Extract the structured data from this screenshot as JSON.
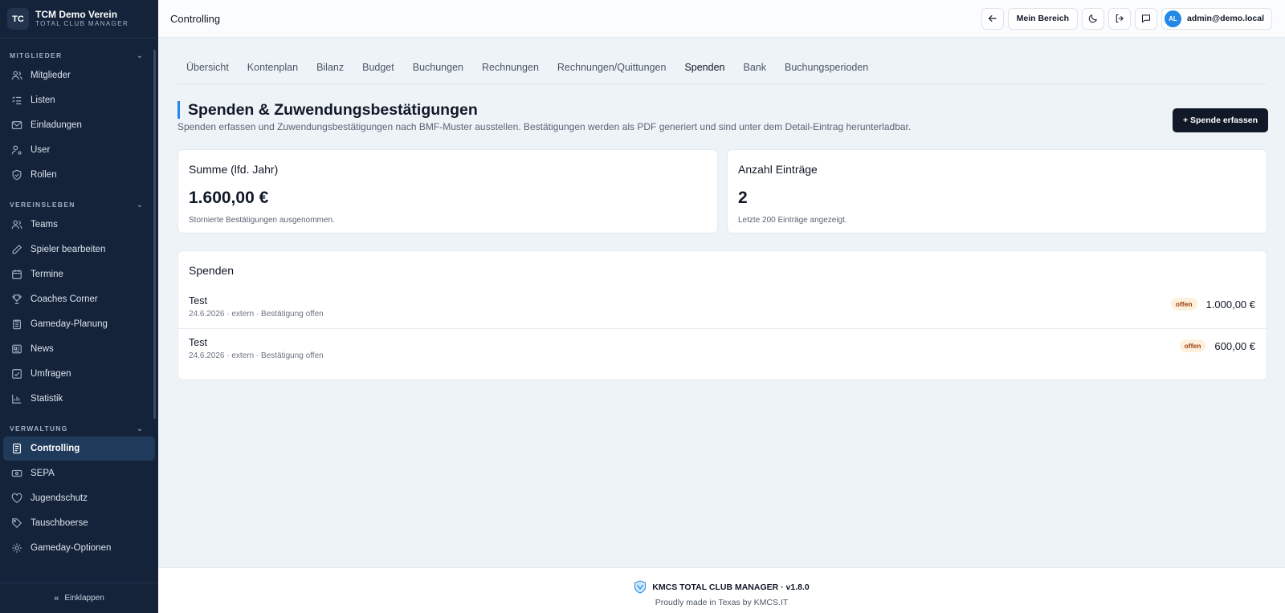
{
  "sidebar": {
    "logo": "TC",
    "org_name": "TCM Demo Verein",
    "org_sub": "TOTAL CLUB MANAGER",
    "sections": [
      {
        "title": "MITGLIEDER",
        "items": [
          {
            "label": "Mitglieder",
            "icon": "users-icon"
          },
          {
            "label": "Listen",
            "icon": "list-icon"
          },
          {
            "label": "Einladungen",
            "icon": "mail-icon"
          },
          {
            "label": "User",
            "icon": "user-cog-icon"
          },
          {
            "label": "Rollen",
            "icon": "shield-icon"
          }
        ]
      },
      {
        "title": "VEREINSLEBEN",
        "items": [
          {
            "label": "Teams",
            "icon": "users-icon"
          },
          {
            "label": "Spieler bearbeiten",
            "icon": "pencil-icon"
          },
          {
            "label": "Termine",
            "icon": "calendar-icon"
          },
          {
            "label": "Coaches Corner",
            "icon": "trophy-icon"
          },
          {
            "label": "Gameday-Planung",
            "icon": "clipboard-icon"
          },
          {
            "label": "News",
            "icon": "newspaper-icon"
          },
          {
            "label": "Umfragen",
            "icon": "poll-icon"
          },
          {
            "label": "Statistik",
            "icon": "bar-chart-icon"
          }
        ]
      },
      {
        "title": "VERWALTUNG",
        "items": [
          {
            "label": "Controlling",
            "icon": "document-icon",
            "active": true
          },
          {
            "label": "SEPA",
            "icon": "banknote-icon"
          },
          {
            "label": "Jugendschutz",
            "icon": "heart-icon"
          },
          {
            "label": "Tauschboerse",
            "icon": "tag-icon"
          },
          {
            "label": "Gameday-Optionen",
            "icon": "settings-icon"
          }
        ]
      }
    ],
    "collapse_label": "Einklappen"
  },
  "topbar": {
    "title": "Controlling",
    "mein_bereich": "Mein Bereich",
    "avatar_initials": "AL",
    "user_email": "admin@demo.local"
  },
  "tabs": [
    "Übersicht",
    "Kontenplan",
    "Bilanz",
    "Budget",
    "Buchungen",
    "Rechnungen",
    "Rechnungen/Quittungen",
    "Spenden",
    "Bank",
    "Buchungsperioden"
  ],
  "active_tab": "Spenden",
  "page": {
    "title": "Spenden & Zuwendungsbestätigungen",
    "description": "Spenden erfassen und Zuwendungsbestätigungen nach BMF-Muster ausstellen. Bestätigungen werden als PDF generiert und sind unter dem Detail-Eintrag herunterladbar.",
    "add_button": "+ Spende erfassen"
  },
  "stats": {
    "sum": {
      "title": "Summe (lfd. Jahr)",
      "value": "1.600,00 €",
      "note": "Stornierte Bestätigungen ausgenommen."
    },
    "count": {
      "title": "Anzahl Einträge",
      "value": "2",
      "note": "Letzte 200 Einträge angezeigt."
    }
  },
  "donations": {
    "title": "Spenden",
    "rows": [
      {
        "name": "Test",
        "meta": "24.6.2026 · extern · Bestätigung offen",
        "status": "offen",
        "amount": "1.000,00 €"
      },
      {
        "name": "Test",
        "meta": "24.6.2026 · extern · Bestätigung offen",
        "status": "offen",
        "amount": "600,00 €"
      }
    ]
  },
  "footer": {
    "brand": "KMCS TOTAL CLUB MANAGER · v1.8.0",
    "tagline": "Proudly made in Texas by KMCS.IT"
  },
  "colors": {
    "accent": "#2388e6",
    "sidebar_bg": "#14233a",
    "primary_button": "#111827",
    "badge_bg": "#fdf0dc"
  }
}
